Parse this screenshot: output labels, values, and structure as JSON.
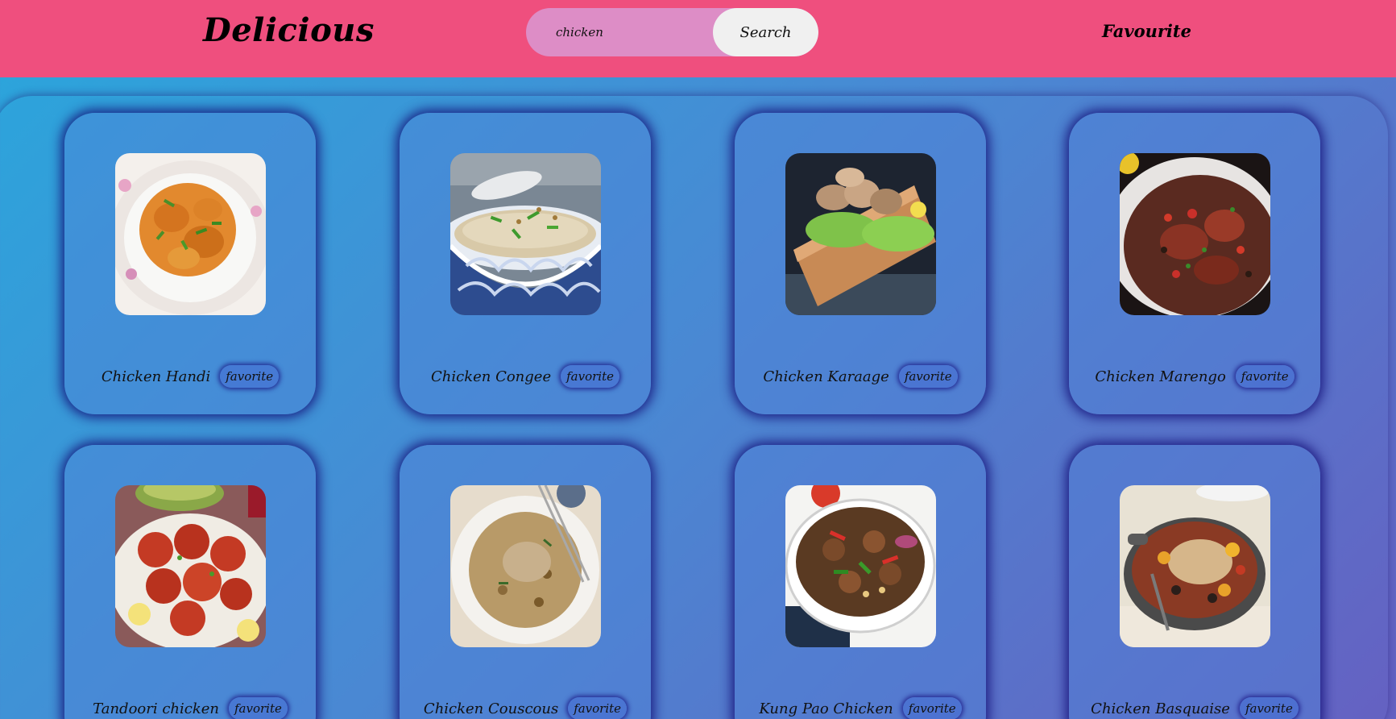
{
  "header": {
    "brand": "Delicious",
    "search": {
      "value": "chicken",
      "placeholder": "",
      "button_label": "Search"
    },
    "favourite_link": "Favourite"
  },
  "recipes": [
    {
      "title": "Chicken Handi",
      "favorite_label": "favorite"
    },
    {
      "title": "Chicken Congee",
      "favorite_label": "favorite"
    },
    {
      "title": "Chicken Karaage",
      "favorite_label": "favorite"
    },
    {
      "title": "Chicken Marengo",
      "favorite_label": "favorite"
    },
    {
      "title": "Tandoori chicken",
      "favorite_label": "favorite"
    },
    {
      "title": "Chicken Couscous",
      "favorite_label": "favorite"
    },
    {
      "title": "Kung Pao Chicken",
      "favorite_label": "favorite"
    },
    {
      "title": "Chicken Basquaise",
      "favorite_label": "favorite"
    }
  ],
  "colors": {
    "header_bg": "#ef4f7e",
    "search_bg": "#dd8dc6",
    "search_button_bg": "#f0f0f0",
    "page_gradient_start": "#2aa6dc",
    "page_gradient_end": "#6561c2"
  }
}
